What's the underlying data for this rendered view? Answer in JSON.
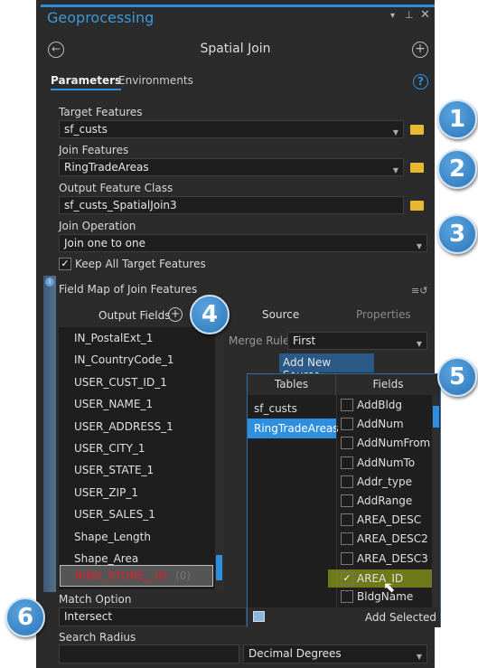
{
  "window": {
    "title": "Geoprocessing",
    "tool_title": "Spatial Join"
  },
  "tabs": [
    {
      "label": "Parameters",
      "active": true
    },
    {
      "label": "Environments",
      "active": false
    }
  ],
  "params": {
    "target_label": "Target Features",
    "target_value": "sf_custs",
    "join_label": "Join Features",
    "join_value": "RingTradeAreas",
    "output_label": "Output Feature Class",
    "output_value": "sf_custs_SpatialJoin3",
    "op_label": "Join Operation",
    "op_value": "Join one to one",
    "keep_label": "Keep All Target Features",
    "keep_checked": true,
    "fieldmap_label": "Field Map of Join Features",
    "match_label": "Match Option",
    "match_value": "Intersect",
    "radius_label": "Search Radius",
    "radius_value": "",
    "radius_unit": "Decimal Degrees"
  },
  "fieldmap": {
    "output_header": "Output Fields",
    "fields": [
      "IN_PostalExt_1",
      "IN_CountryCode_1",
      "USER_CUST_ID_1",
      "USER_NAME_1",
      "USER_ADDRESS_1",
      "USER_CITY_1",
      "USER_STATE_1",
      "USER_ZIP_1",
      "USER_SALES_1",
      "Shape_Length",
      "Shape_Area"
    ],
    "selected_field": "RING_STORE__ID",
    "selected_count": "(0)",
    "source_tab": "Source",
    "properties_tab": "Properties",
    "merge_label": "Merge Rule",
    "merge_value": "First",
    "add_source_label": "Add New Source"
  },
  "popup": {
    "tables_header": "Tables",
    "fields_header": "Fields",
    "tables": [
      "sf_custs",
      "RingTradeAreas"
    ],
    "selected_table": "RingTradeAreas",
    "fields": [
      {
        "name": "AddBldg",
        "checked": false
      },
      {
        "name": "AddNum",
        "checked": false
      },
      {
        "name": "AddNumFrom",
        "checked": false
      },
      {
        "name": "AddNumTo",
        "checked": false
      },
      {
        "name": "Addr_type",
        "checked": false
      },
      {
        "name": "AddRange",
        "checked": false
      },
      {
        "name": "AREA_DESC",
        "checked": false
      },
      {
        "name": "AREA_DESC2",
        "checked": false
      },
      {
        "name": "AREA_DESC3",
        "checked": false
      },
      {
        "name": "AREA_ID",
        "checked": true
      },
      {
        "name": "BldgName",
        "checked": false
      }
    ],
    "add_selected_label": "Add Selected"
  },
  "callouts": [
    "1",
    "2",
    "3",
    "4",
    "5",
    "6"
  ],
  "colors": {
    "accent": "#2f8fdf",
    "panel": "#2b2b2b",
    "highlight": "#8a9a1a",
    "error_text": "#e0202a"
  }
}
